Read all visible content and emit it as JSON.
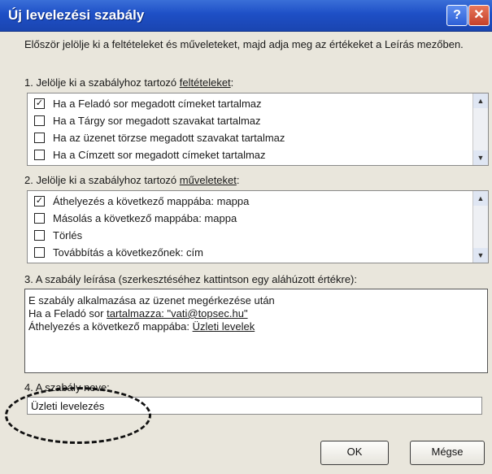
{
  "dialog": {
    "title": "Új levelezési szabály",
    "help_glyph": "?",
    "close_glyph": "✕"
  },
  "intro": "Először jelölje ki a feltételeket és műveleteket, majd adja meg az értékeket a Leírás mezőben.",
  "conditions": {
    "label_prefix": "1. Jelölje ki a szabályhoz tartozó ",
    "label_underlined": "feltételeket",
    "label_suffix": ":",
    "items": [
      {
        "label": "Ha a Feladó sor megadott címeket tartalmaz",
        "checked": true
      },
      {
        "label": "Ha a Tárgy sor megadott szavakat tartalmaz",
        "checked": false
      },
      {
        "label": "Ha az üzenet törzse megadott szavakat tartalmaz",
        "checked": false
      },
      {
        "label": "Ha a Címzett sor megadott címeket tartalmaz",
        "checked": false
      }
    ]
  },
  "actions": {
    "label_prefix": "2. Jelölje ki a szabályhoz tartozó ",
    "label_underlined": "műveleteket",
    "label_suffix": ":",
    "items": [
      {
        "label": "Áthelyezés a következő mappába: mappa",
        "checked": true
      },
      {
        "label": "Másolás a következő mappába: mappa",
        "checked": false
      },
      {
        "label": "Törlés",
        "checked": false
      },
      {
        "label": "Továbbítás a következőnek: cím",
        "checked": false
      }
    ]
  },
  "description": {
    "label": "3. A szabály leírása (szerkesztéséhez kattintson egy aláhúzott értékre):",
    "line1": "E szabály alkalmazása az üzenet megérkezése után",
    "line2_prefix": "Ha a Feladó sor ",
    "line2_link": "tartalmazza: \"vati@topsec.hu\"",
    "line3_prefix": "Áthelyezés a következő mappába: ",
    "line3_link": "Üzleti levelek"
  },
  "rule_name": {
    "label": "4. A szabály neve:",
    "value": "Üzleti levelezés"
  },
  "buttons": {
    "ok": "OK",
    "cancel": "Mégse"
  },
  "glyphs": {
    "check": "✓",
    "scroll_up": "▲",
    "scroll_down": "▼"
  },
  "colors": {
    "titlebar": "#1e4fc6",
    "dialog_bg": "#e9e6dc"
  }
}
